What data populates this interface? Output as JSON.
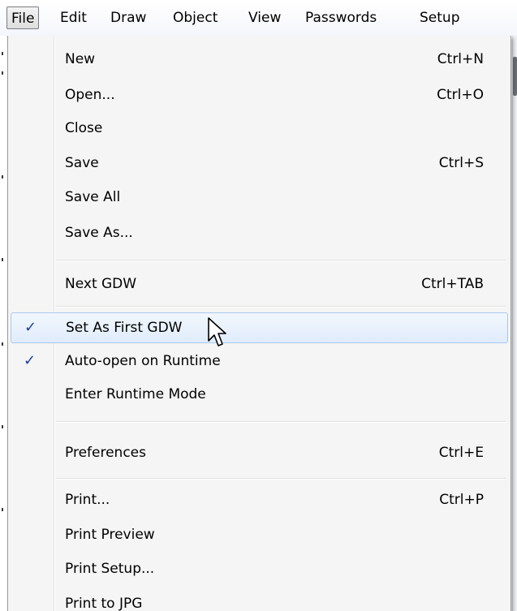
{
  "menubar": {
    "items": [
      {
        "label": "File"
      },
      {
        "label": "Edit"
      },
      {
        "label": "Draw"
      },
      {
        "label": "Object"
      },
      {
        "label": "View"
      },
      {
        "label": "Passwords"
      },
      {
        "label": "Setup"
      }
    ],
    "active_index": 0
  },
  "file_menu": {
    "items": [
      {
        "label": "New",
        "shortcut": "Ctrl+N"
      },
      {
        "label": "Open...",
        "shortcut": "Ctrl+O"
      },
      {
        "label": "Close",
        "shortcut": ""
      },
      {
        "label": "Save",
        "shortcut": "Ctrl+S"
      },
      {
        "label": "Save All",
        "shortcut": ""
      },
      {
        "label": "Save As...",
        "shortcut": ""
      },
      {
        "label": "Next GDW",
        "shortcut": "Ctrl+TAB"
      },
      {
        "label": "Set As First GDW",
        "shortcut": "",
        "checked": true,
        "highlighted": true
      },
      {
        "label": "Auto-open on Runtime",
        "shortcut": "",
        "checked": true
      },
      {
        "label": "Enter Runtime Mode",
        "shortcut": ""
      },
      {
        "label": "Preferences",
        "shortcut": "Ctrl+E"
      },
      {
        "label": "Print...",
        "shortcut": "Ctrl+P"
      },
      {
        "label": "Print Preview",
        "shortcut": ""
      },
      {
        "label": "Print Setup...",
        "shortcut": ""
      },
      {
        "label": "Print to JPG",
        "shortcut": ""
      }
    ],
    "check_glyph": "✓"
  },
  "colors": {
    "menu_background": "#f5f5f5",
    "highlight_fill": "#e0ecfb",
    "highlight_border": "#a9c7ee",
    "check_color": "#1f3f9e"
  },
  "icons": {
    "check": "check-icon",
    "cursor": "mouse-pointer-icon"
  }
}
